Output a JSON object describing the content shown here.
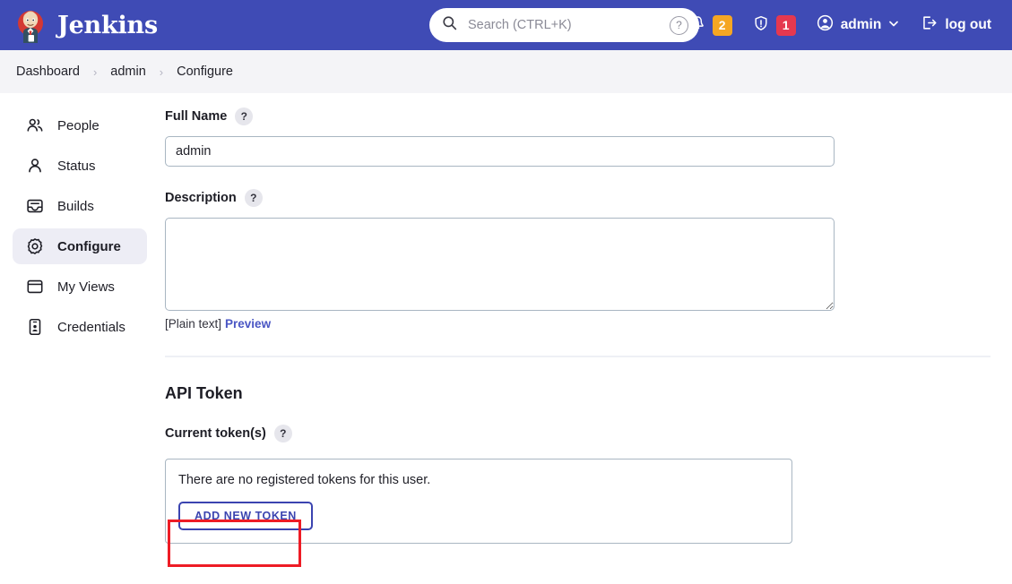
{
  "header": {
    "brand": "Jenkins",
    "brand_logo_icon": "jenkins-butler-logo",
    "search": {
      "placeholder": "Search (CTRL+K)",
      "value": "",
      "icon": "search-icon",
      "help_icon": "question-mark-circle-icon"
    },
    "notifications": {
      "icon": "bell-icon",
      "count": "2",
      "color": "#f5a623"
    },
    "security": {
      "icon": "shield-exclamation-icon",
      "count": "1",
      "color": "#e5384f"
    },
    "user": {
      "icon": "user-circle-icon",
      "label": "admin",
      "chevron": "chevron-down-icon"
    },
    "logout": {
      "icon": "logout-arrow-icon",
      "label": "log out"
    },
    "background": "#3f4bb5"
  },
  "breadcrumb": {
    "separator": "›",
    "items": [
      {
        "label": "Dashboard"
      },
      {
        "label": "admin"
      },
      {
        "label": "Configure"
      }
    ]
  },
  "sidebar": {
    "items": [
      {
        "label": "People",
        "icon": "people-icon",
        "active": false
      },
      {
        "label": "Status",
        "icon": "person-icon",
        "active": false
      },
      {
        "label": "Builds",
        "icon": "builds-tray-icon",
        "active": false
      },
      {
        "label": "Configure",
        "icon": "gear-icon",
        "active": true
      },
      {
        "label": "My Views",
        "icon": "window-icon",
        "active": false
      },
      {
        "label": "Credentials",
        "icon": "credentials-card-icon",
        "active": false
      }
    ]
  },
  "main": {
    "full_name": {
      "label": "Full Name",
      "help": "?",
      "value": "admin",
      "placeholder": ""
    },
    "description": {
      "label": "Description",
      "help": "?",
      "value": "",
      "placeholder": "",
      "markup_note": "[Plain text]",
      "preview_link": "Preview"
    },
    "api_token": {
      "section_title": "API Token",
      "current_label": "Current token(s)",
      "help": "?",
      "empty_message": "There are no registered tokens for this user.",
      "add_button": "ADD NEW TOKEN"
    }
  },
  "annotation": {
    "target": "add-new-token-button",
    "color": "#ee1c25"
  }
}
